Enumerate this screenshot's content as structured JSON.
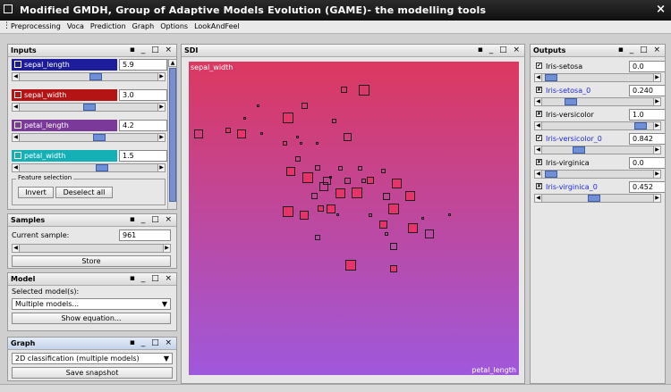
{
  "window": {
    "title": "Modified GMDH, Group of Adaptive Models Evolution (GAME)- the modelling tools",
    "close_glyph": "×"
  },
  "menu": [
    "Preprocessing",
    "Voca",
    "Prediction",
    "Graph",
    "Options",
    "LookAndFeel"
  ],
  "inputs": {
    "title": "Inputs",
    "controls": "▪ _ □ ×",
    "variables": [
      {
        "name": "sepal_length",
        "value": "5.9",
        "color": "#1d1d9c",
        "slider": 0.55
      },
      {
        "name": "sepal_width",
        "value": "3.0",
        "color": "#b51414",
        "slider": 0.5
      },
      {
        "name": "petal_length",
        "value": "4.2",
        "color": "#7b3a9a",
        "slider": 0.58
      },
      {
        "name": "petal_width",
        "value": "1.5",
        "color": "#14b0b5",
        "slider": 0.6
      }
    ],
    "feature_selection": {
      "legend": "Feature selection",
      "invert": "Invert",
      "deselect": "Deselect all"
    }
  },
  "samples": {
    "title": "Samples",
    "controls": "▪ _ □ ×",
    "current_label": "Current sample:",
    "current_value": "961",
    "store": "Store"
  },
  "model": {
    "title": "Model",
    "controls": "▪ _ □ ×",
    "selected_label": "Selected model(s):",
    "selected_value": "Multiple models...",
    "show_equation": "Show equation..."
  },
  "graph": {
    "title": "Graph",
    "controls": "▪ _ □ ×",
    "type_value": "2D classification (multiple models)",
    "save": "Save snapshot"
  },
  "plot_panel": {
    "title": "SDI",
    "controls": "▪ _ □ ×",
    "y_axis": "sepal_width",
    "x_axis": "petal_length",
    "colors": {
      "top": "#dc3860",
      "bottom": "#9f58dc"
    },
    "points": [
      {
        "x": 0.47,
        "y": 0.09,
        "s": 7,
        "f": "n"
      },
      {
        "x": 0.53,
        "y": 0.09,
        "s": 12,
        "f": "n"
      },
      {
        "x": 0.21,
        "y": 0.14,
        "s": 3,
        "f": "r"
      },
      {
        "x": 0.35,
        "y": 0.14,
        "s": 7,
        "f": "n"
      },
      {
        "x": 0.3,
        "y": 0.18,
        "s": 12,
        "f": "r"
      },
      {
        "x": 0.17,
        "y": 0.18,
        "s": 3,
        "f": "r"
      },
      {
        "x": 0.44,
        "y": 0.19,
        "s": 5,
        "f": "n"
      },
      {
        "x": 0.12,
        "y": 0.22,
        "s": 6,
        "f": "r"
      },
      {
        "x": 0.16,
        "y": 0.23,
        "s": 10,
        "f": "r"
      },
      {
        "x": 0.03,
        "y": 0.23,
        "s": 10,
        "f": "n"
      },
      {
        "x": 0.22,
        "y": 0.23,
        "s": 3,
        "f": "n"
      },
      {
        "x": 0.33,
        "y": 0.24,
        "s": 3,
        "f": "n"
      },
      {
        "x": 0.48,
        "y": 0.24,
        "s": 9,
        "f": "n"
      },
      {
        "x": 0.29,
        "y": 0.26,
        "s": 5,
        "f": "r"
      },
      {
        "x": 0.34,
        "y": 0.26,
        "s": 3,
        "f": "n"
      },
      {
        "x": 0.39,
        "y": 0.26,
        "s": 3,
        "f": "n"
      },
      {
        "x": 0.33,
        "y": 0.31,
        "s": 6,
        "f": "n"
      },
      {
        "x": 0.31,
        "y": 0.35,
        "s": 10,
        "f": "r"
      },
      {
        "x": 0.39,
        "y": 0.34,
        "s": 6,
        "f": "n"
      },
      {
        "x": 0.46,
        "y": 0.34,
        "s": 5,
        "f": "n"
      },
      {
        "x": 0.52,
        "y": 0.34,
        "s": 5,
        "f": "n"
      },
      {
        "x": 0.59,
        "y": 0.35,
        "s": 5,
        "f": "n"
      },
      {
        "x": 0.55,
        "y": 0.38,
        "s": 8,
        "f": "r"
      },
      {
        "x": 0.36,
        "y": 0.37,
        "s": 12,
        "f": "r"
      },
      {
        "x": 0.43,
        "y": 0.37,
        "s": 3,
        "f": "n"
      },
      {
        "x": 0.41,
        "y": 0.4,
        "s": 10,
        "f": "n"
      },
      {
        "x": 0.42,
        "y": 0.38,
        "s": 9,
        "f": "n"
      },
      {
        "x": 0.48,
        "y": 0.38,
        "s": 7,
        "f": "n"
      },
      {
        "x": 0.53,
        "y": 0.38,
        "s": 5,
        "f": "n"
      },
      {
        "x": 0.63,
        "y": 0.39,
        "s": 11,
        "f": "r"
      },
      {
        "x": 0.46,
        "y": 0.42,
        "s": 11,
        "f": "r"
      },
      {
        "x": 0.51,
        "y": 0.42,
        "s": 12,
        "f": "r"
      },
      {
        "x": 0.67,
        "y": 0.43,
        "s": 11,
        "f": "r"
      },
      {
        "x": 0.38,
        "y": 0.43,
        "s": 7,
        "f": "n"
      },
      {
        "x": 0.6,
        "y": 0.43,
        "s": 8,
        "f": "n"
      },
      {
        "x": 0.4,
        "y": 0.47,
        "s": 7,
        "f": "r"
      },
      {
        "x": 0.43,
        "y": 0.47,
        "s": 10,
        "f": "r"
      },
      {
        "x": 0.62,
        "y": 0.47,
        "s": 12,
        "f": "r"
      },
      {
        "x": 0.3,
        "y": 0.48,
        "s": 12,
        "f": "r"
      },
      {
        "x": 0.35,
        "y": 0.49,
        "s": 10,
        "f": "r"
      },
      {
        "x": 0.45,
        "y": 0.49,
        "s": 3,
        "f": "n"
      },
      {
        "x": 0.55,
        "y": 0.49,
        "s": 4,
        "f": "n"
      },
      {
        "x": 0.59,
        "y": 0.52,
        "s": 9,
        "f": "r"
      },
      {
        "x": 0.79,
        "y": 0.49,
        "s": 3,
        "f": "n"
      },
      {
        "x": 0.71,
        "y": 0.5,
        "s": 3,
        "f": "n"
      },
      {
        "x": 0.68,
        "y": 0.53,
        "s": 11,
        "f": "r"
      },
      {
        "x": 0.73,
        "y": 0.55,
        "s": 10,
        "f": "n"
      },
      {
        "x": 0.6,
        "y": 0.55,
        "s": 4,
        "f": "n"
      },
      {
        "x": 0.39,
        "y": 0.56,
        "s": 6,
        "f": "n"
      },
      {
        "x": 0.62,
        "y": 0.59,
        "s": 8,
        "f": "n"
      },
      {
        "x": 0.49,
        "y": 0.65,
        "s": 12,
        "f": "r"
      },
      {
        "x": 0.62,
        "y": 0.66,
        "s": 8,
        "f": "r"
      }
    ]
  },
  "outputs": {
    "title": "Outputs",
    "controls": "▪ _ □ ×",
    "items": [
      {
        "name": "Iris-setosa",
        "value": "0.0",
        "blue": false,
        "check": "✔",
        "slider": 0.02
      },
      {
        "name": "Iris-setosa_0",
        "value": "0.240",
        "blue": true,
        "check": "✘",
        "slider": 0.22
      },
      {
        "name": "Iris-versicolor",
        "value": "1.0",
        "blue": false,
        "check": "✘",
        "slider": 0.93
      },
      {
        "name": "Iris-versicolor_0",
        "value": "0.842",
        "blue": true,
        "check": "✔",
        "slider": 0.3
      },
      {
        "name": "Iris-virginica",
        "value": "0.0",
        "blue": false,
        "check": "✘",
        "slider": 0.02
      },
      {
        "name": "Iris-virginica_0",
        "value": "0.452",
        "blue": true,
        "check": "✘",
        "slider": 0.45
      }
    ]
  }
}
